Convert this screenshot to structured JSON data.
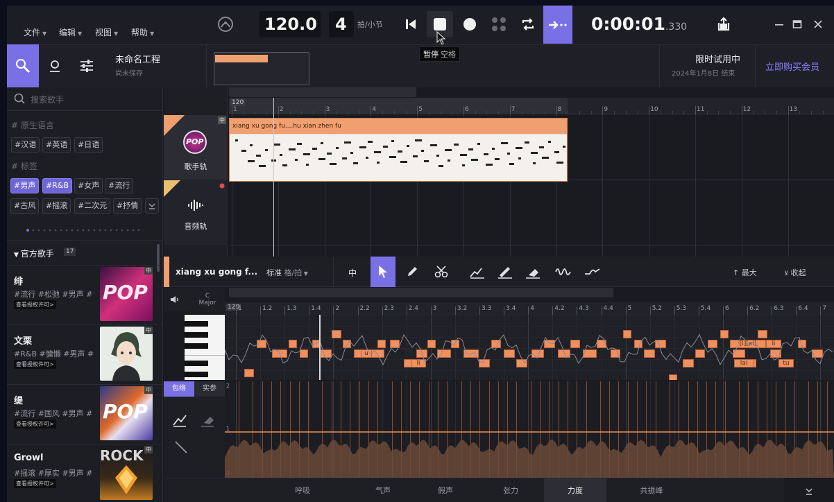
{
  "menu": [
    {
      "label": "文件"
    },
    {
      "label": "编辑"
    },
    {
      "label": "视图"
    },
    {
      "label": "帮助"
    }
  ],
  "transport": {
    "tempo": "120.0",
    "beats": "4",
    "beats_unit": "拍/小节",
    "time_main": "0:00:01",
    "time_ms": ".330"
  },
  "tooltip": {
    "label": "暂停",
    "key": "空格"
  },
  "project": {
    "name": "未命名工程",
    "status": "尚未保存",
    "trial_title": "限时试用中",
    "trial_end": "2024年1月8日 结束",
    "buy_label": "立即购买会员"
  },
  "search": {
    "placeholder": "搜索歌手"
  },
  "sections": {
    "native_lang": "# 原生语言",
    "tags": "# 标签",
    "official": "官方歌手",
    "official_count": "17"
  },
  "lang_tags": [
    "#汉语",
    "#英语",
    "#日语"
  ],
  "style_tags": [
    {
      "label": "#男声",
      "on": true
    },
    {
      "label": "#R&B",
      "on": true
    },
    {
      "label": "#女声",
      "on": false
    },
    {
      "label": "#流行",
      "on": false
    },
    {
      "label": "#古风",
      "on": false
    },
    {
      "label": "#摇滚",
      "on": false
    },
    {
      "label": "#二次元",
      "on": false
    },
    {
      "label": "#抒情",
      "on": false
    }
  ],
  "singers": [
    {
      "name": "绯",
      "tags": "#流行 #松弛 #男声 #",
      "license": "查看授权许可>",
      "badge": "中",
      "art": "POP"
    },
    {
      "name": "文栗",
      "tags": "#R&B #慵懒 #男声 #",
      "license": "查看授权许可>",
      "badge": "中",
      "art": ""
    },
    {
      "name": "缇",
      "tags": "#流行 #国风 #男声 #",
      "license": "查看授权许可>",
      "badge": "中",
      "art": "POP"
    },
    {
      "name": "Growl",
      "tags": "#摇滚 #厚实 #男声 #",
      "license": "查看授权许可>",
      "badge": "中",
      "art": "ROCK"
    }
  ],
  "tracks": [
    {
      "name": "歌手轨",
      "badge": "中",
      "logo": "POP"
    },
    {
      "name": "音频轨"
    }
  ],
  "arrangement": {
    "tempo_marker": "120",
    "bars": [
      "1",
      "2",
      "3",
      "4",
      "5",
      "6",
      "7",
      "8",
      "9",
      "10",
      "11",
      "12",
      "13"
    ],
    "clip_lyrics": "xiang xu gong fu....hu xian zhen fu"
  },
  "editor": {
    "clip_name": "xiang xu gong f...",
    "quantize_label": "标准",
    "quantize_unit": "格/拍",
    "lang_label": "中",
    "max_label": "最大",
    "collapse_label": "收起",
    "key": "C",
    "mode": "Major",
    "tempo_marker": "120",
    "beats": [
      "1",
      "1.2",
      "1.3",
      "1.4",
      "2",
      "2.2",
      "2.3",
      "2.4",
      "3",
      "3.2",
      "3.3",
      "3.4",
      "4",
      "4.2",
      "4.3",
      "4.4",
      "5",
      "5.2",
      "5.3",
      "5.4",
      "6",
      "6.2",
      "6.3",
      "6.4",
      "7"
    ],
    "param_tabs": [
      {
        "label": "包络",
        "on": true
      },
      {
        "label": "实参",
        "on": false
      }
    ],
    "param_top": "2",
    "param_mid": "1",
    "param_bottom": "0",
    "note_labels": [
      "u",
      "li",
      "[l][ai]",
      "lai",
      "li",
      "tu"
    ]
  },
  "bottom_tabs": [
    {
      "label": "呼吸",
      "on": false
    },
    {
      "label": "气声",
      "on": false
    },
    {
      "label": "假声",
      "on": false
    },
    {
      "label": "张力",
      "on": false
    },
    {
      "label": "力度",
      "on": true
    },
    {
      "label": "共振峰",
      "on": false
    }
  ],
  "colors": {
    "accent": "#7a70e6",
    "note": "#ef9060",
    "clip": "#f0a070",
    "buy": "#8a82ff"
  }
}
